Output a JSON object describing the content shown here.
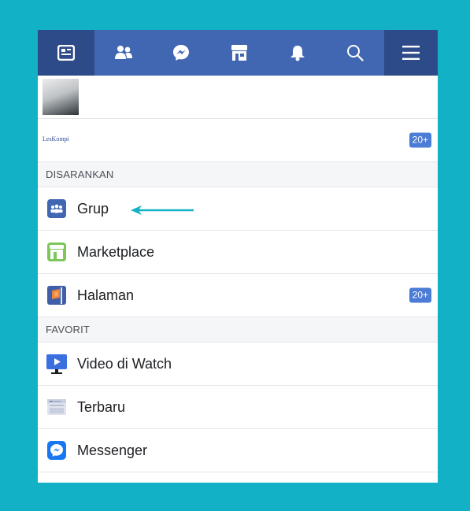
{
  "colors": {
    "background": "#13b1c6",
    "nav_bar": "#4267b2",
    "nav_active": "#2d4b88",
    "badge": "#4b7cd6",
    "arrow": "#13b1c6"
  },
  "nav": {
    "tabs": [
      {
        "icon": "news-feed-icon"
      },
      {
        "icon": "friends-icon"
      },
      {
        "icon": "messenger-icon"
      },
      {
        "icon": "marketplace-icon"
      },
      {
        "icon": "notifications-bell-icon"
      },
      {
        "icon": "search-icon"
      },
      {
        "icon": "hamburger-menu-icon"
      }
    ]
  },
  "shortcuts": {
    "items": [
      {
        "icon": "photo-thumbnail"
      },
      {
        "logo_text": "LesKompi",
        "badge": "20+"
      }
    ]
  },
  "suggested": {
    "header": "DISARANKAN",
    "items": [
      {
        "label": "Grup",
        "icon": "groups-icon"
      },
      {
        "label": "Marketplace",
        "icon": "marketplace-store-icon"
      },
      {
        "label": "Halaman",
        "icon": "pages-flag-icon",
        "badge": "20+"
      }
    ]
  },
  "favorites": {
    "header": "FAVORIT",
    "items": [
      {
        "label": "Video di Watch",
        "icon": "watch-video-icon"
      },
      {
        "label": "Terbaru",
        "icon": "most-recent-icon"
      },
      {
        "label": "Messenger",
        "icon": "messenger-app-icon"
      }
    ]
  }
}
